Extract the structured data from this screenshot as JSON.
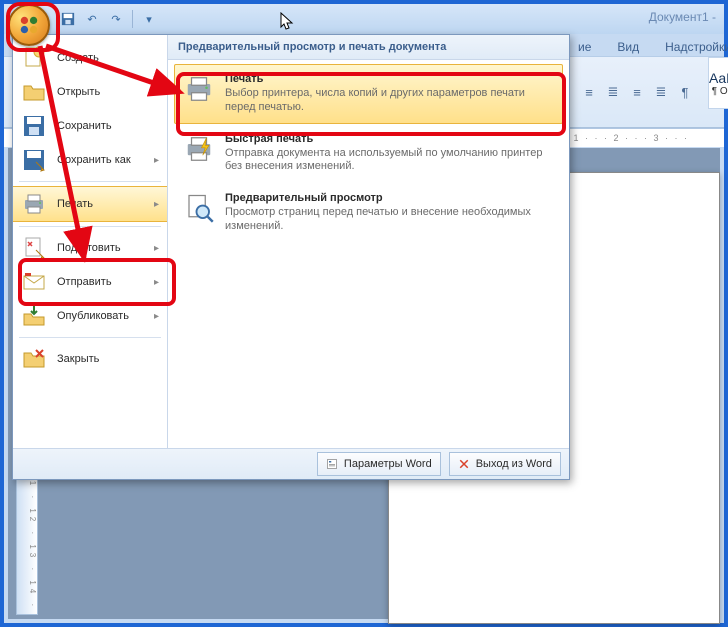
{
  "window": {
    "title": "Документ1 -"
  },
  "ribbon": {
    "tabs": [
      "ие",
      "Вид",
      "Надстройки"
    ],
    "style_sample": "AaBb",
    "style_name": "¶ Обы"
  },
  "ruler": {
    "top": "· 1 · · · 2 · · · 3 · · ·"
  },
  "vruler": "· 1 · 2 · 3 · 4 · 5 · 6 · 7 · 8 · 9 · 10 · 11 · 12 · 13 · 14 ·",
  "menu": {
    "header": "Предварительный просмотр и печать документа",
    "left": [
      {
        "label": "Создать",
        "arrow": false
      },
      {
        "label": "Открыть",
        "arrow": false
      },
      {
        "label": "Сохранить",
        "arrow": false
      },
      {
        "label": "Сохранить как",
        "arrow": true
      },
      {
        "label": "Печать",
        "arrow": true
      },
      {
        "label": "Подготовить",
        "arrow": true
      },
      {
        "label": "Отправить",
        "arrow": true
      },
      {
        "label": "Опубликовать",
        "arrow": true
      },
      {
        "label": "Закрыть",
        "arrow": false
      }
    ],
    "right": [
      {
        "title": "Печать",
        "desc": "Выбор принтера, числа копий и других параметров печати перед печатью."
      },
      {
        "title": "Быстрая печать",
        "desc": "Отправка документа на используемый по умолчанию принтер без внесения изменений."
      },
      {
        "title": "Предварительный просмотр",
        "desc": "Просмотр страниц перед печатью и внесение необходимых изменений."
      }
    ],
    "footer": {
      "options": "Параметры Word",
      "exit": "Выход из Word"
    }
  }
}
